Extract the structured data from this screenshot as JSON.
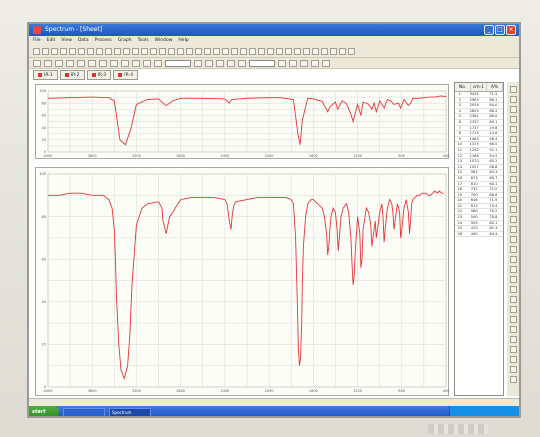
{
  "window": {
    "title": "Spectrum - [Sheet]"
  },
  "menubar": {
    "items": [
      "File",
      "Edit",
      "View",
      "Data",
      "Process",
      "Graph",
      "Tools",
      "Window",
      "Help"
    ]
  },
  "tabs": [
    {
      "label": "IR-1"
    },
    {
      "label": "IR-2"
    },
    {
      "label": "IR-3"
    },
    {
      "label": "IR-4"
    }
  ],
  "peak_table": {
    "headers": [
      "No.",
      "cm-1",
      "A%"
    ],
    "rows": [
      [
        "1",
        "3425",
        "71.2"
      ],
      [
        "2",
        "2963",
        "86.1"
      ],
      [
        "3",
        "2926",
        "84.0"
      ],
      [
        "4",
        "2855",
        "88.2"
      ],
      [
        "5",
        "2361",
        "86.0"
      ],
      [
        "6",
        "2337",
        "89.1"
      ],
      [
        "7",
        "1737",
        "19.8"
      ],
      [
        "8",
        "1715",
        "14.6"
      ],
      [
        "9",
        "1465",
        "58.4"
      ],
      [
        "10",
        "1375",
        "66.0"
      ],
      [
        "11",
        "1242",
        "52.1"
      ],
      [
        "12",
        "1166",
        "54.5"
      ],
      [
        "13",
        "1070",
        "60.2"
      ],
      [
        "14",
        "1027",
        "58.8"
      ],
      [
        "15",
        "963",
        "63.3"
      ],
      [
        "16",
        "873",
        "69.7"
      ],
      [
        "17",
        "810",
        "64.1"
      ],
      [
        "18",
        "735",
        "72.0"
      ],
      [
        "19",
        "700",
        "68.6"
      ],
      [
        "20",
        "648",
        "71.9"
      ],
      [
        "21",
        "615",
        "73.4"
      ],
      [
        "22",
        "580",
        "76.2"
      ],
      [
        "23",
        "540",
        "78.8"
      ],
      [
        "24",
        "505",
        "80.1"
      ],
      [
        "25",
        "470",
        "82.3"
      ],
      [
        "26",
        "440",
        "84.4"
      ]
    ]
  },
  "taskbar": {
    "start": "start",
    "items": [
      "",
      "Spectrum"
    ],
    "clock": ""
  },
  "colors": {
    "spectrum": "#e23636",
    "grid": "#d8d8d0"
  },
  "chart_data": [
    {
      "type": "line",
      "x": [
        4000,
        3800,
        3600,
        3450,
        3400,
        3380,
        3350,
        3300,
        3250,
        3200,
        3100,
        3000,
        2960,
        2930,
        2870,
        2800,
        2600,
        2400,
        2360,
        2340,
        2200,
        2000,
        1900,
        1780,
        1740,
        1720,
        1700,
        1650,
        1600,
        1520,
        1470,
        1450,
        1400,
        1380,
        1340,
        1300,
        1260,
        1240,
        1200,
        1170,
        1150,
        1100,
        1070,
        1050,
        1030,
        1000,
        960,
        930,
        900,
        870,
        830,
        810,
        780,
        740,
        720,
        700,
        650,
        600,
        550,
        500,
        450,
        400
      ],
      "y": [
        88,
        89,
        90,
        89,
        84,
        60,
        20,
        12,
        38,
        78,
        86,
        87,
        80,
        76,
        84,
        88,
        88,
        87,
        80,
        86,
        88,
        89,
        89,
        86,
        30,
        12,
        52,
        88,
        87,
        83,
        66,
        74,
        82,
        70,
        84,
        79,
        62,
        50,
        78,
        60,
        82,
        78,
        70,
        80,
        66,
        84,
        72,
        86,
        84,
        78,
        80,
        72,
        86,
        76,
        80,
        88,
        88,
        89,
        90,
        90,
        92,
        91
      ],
      "xlim": [
        4000,
        400
      ],
      "ylim": [
        0,
        100
      ]
    },
    {
      "type": "line",
      "x": [
        4000,
        3900,
        3800,
        3700,
        3600,
        3500,
        3450,
        3420,
        3400,
        3390,
        3380,
        3360,
        3340,
        3310,
        3280,
        3260,
        3240,
        3200,
        3150,
        3100,
        3000,
        2970,
        2960,
        2940,
        2930,
        2920,
        2900,
        2870,
        2850,
        2800,
        2700,
        2600,
        2500,
        2400,
        2380,
        2360,
        2345,
        2335,
        2320,
        2300,
        2200,
        2100,
        2000,
        1900,
        1850,
        1800,
        1780,
        1760,
        1745,
        1735,
        1725,
        1715,
        1705,
        1700,
        1690,
        1670,
        1650,
        1620,
        1600,
        1560,
        1520,
        1500,
        1480,
        1470,
        1460,
        1450,
        1440,
        1420,
        1400,
        1385,
        1375,
        1365,
        1350,
        1330,
        1300,
        1280,
        1260,
        1250,
        1240,
        1230,
        1220,
        1200,
        1180,
        1170,
        1160,
        1150,
        1120,
        1100,
        1080,
        1070,
        1060,
        1040,
        1030,
        1020,
        1000,
        980,
        970,
        960,
        950,
        930,
        910,
        890,
        880,
        870,
        860,
        840,
        820,
        810,
        800,
        780,
        760,
        740,
        730,
        720,
        710,
        700,
        680,
        660,
        640,
        620,
        600,
        580,
        560,
        540,
        520,
        500,
        480,
        460,
        440,
        420,
        400
      ],
      "y": [
        90,
        90,
        91,
        91,
        90,
        90,
        88,
        84,
        74,
        60,
        42,
        20,
        8,
        4,
        10,
        24,
        48,
        76,
        84,
        86,
        87,
        84,
        78,
        74,
        72,
        75,
        80,
        82,
        84,
        88,
        89,
        89,
        89,
        88,
        86,
        78,
        74,
        80,
        85,
        87,
        88,
        89,
        89,
        89,
        89,
        88,
        86,
        70,
        40,
        18,
        10,
        14,
        30,
        48,
        66,
        80,
        86,
        88,
        88,
        86,
        84,
        80,
        72,
        62,
        66,
        74,
        80,
        84,
        82,
        74,
        64,
        70,
        80,
        84,
        86,
        82,
        70,
        58,
        48,
        52,
        64,
        80,
        72,
        56,
        60,
        74,
        84,
        82,
        76,
        66,
        70,
        78,
        70,
        74,
        82,
        86,
        80,
        68,
        74,
        84,
        88,
        86,
        82,
        74,
        78,
        86,
        82,
        70,
        74,
        84,
        88,
        82,
        72,
        78,
        86,
        88,
        89,
        90,
        90,
        91,
        91,
        91,
        90,
        90,
        91,
        92,
        91,
        92,
        91,
        91
      ],
      "xlim": [
        4000,
        400
      ],
      "ylim": [
        0,
        100
      ]
    }
  ]
}
